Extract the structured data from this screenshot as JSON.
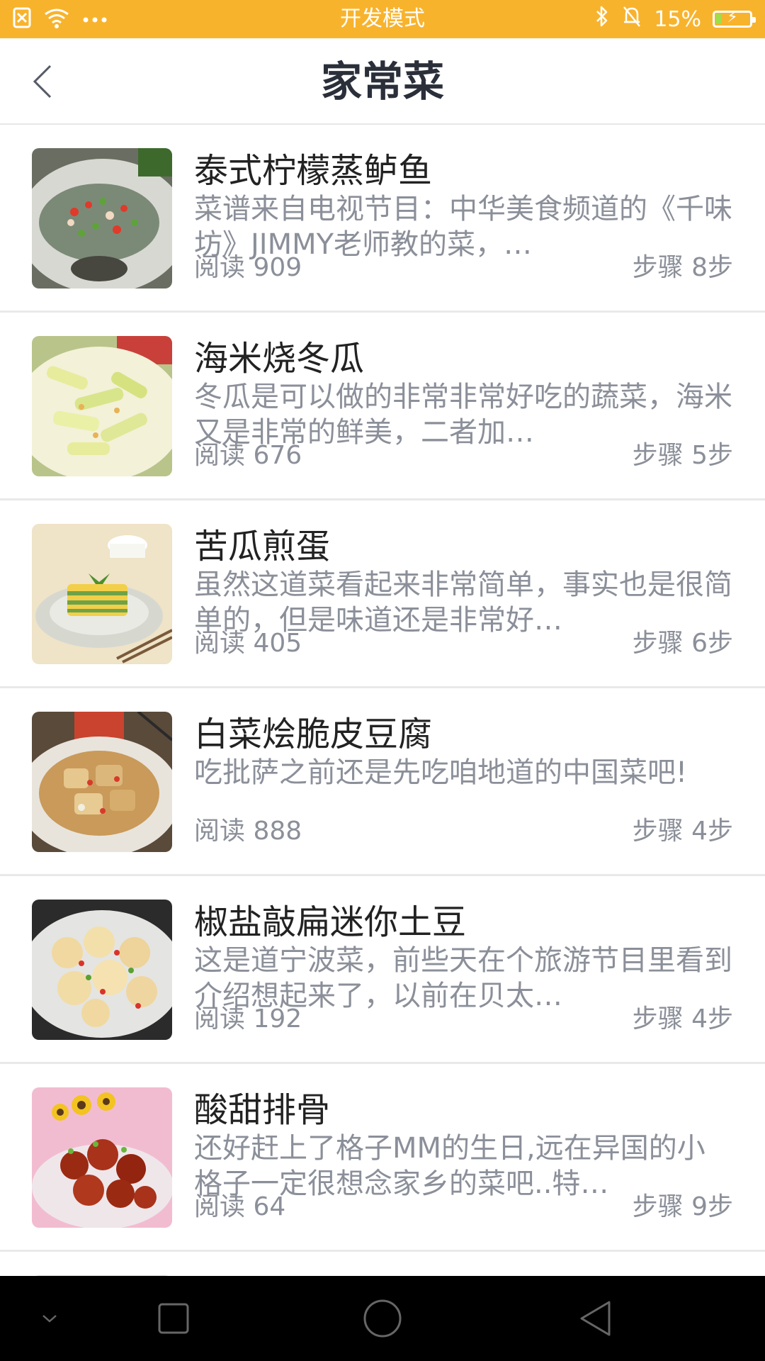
{
  "status_bar": {
    "center_text": "开发模式",
    "battery_text": "15%",
    "battery_level": 0.15,
    "background_color": "#f8b32d"
  },
  "nav": {
    "title": "家常菜"
  },
  "recipes": [
    {
      "title": "泰式柠檬蒸鲈鱼",
      "description": "菜谱来自电视节目：中华美食频道的《千味坊》JIMMY老师教的菜，…",
      "reads": "阅读  909",
      "steps": "步骤  8步"
    },
    {
      "title": "海米烧冬瓜",
      "description": "冬瓜是可以做的非常非常好吃的蔬菜，海米又是非常的鲜美，二者加…",
      "reads": "阅读  676",
      "steps": "步骤  5步"
    },
    {
      "title": "苦瓜煎蛋",
      "description": "虽然这道菜看起来非常简单，事实也是很简单的，但是味道还是非常好…",
      "reads": "阅读  405",
      "steps": "步骤  6步"
    },
    {
      "title": "白菜烩脆皮豆腐",
      "description": "吃批萨之前还是先吃咱地道的中国菜吧!",
      "reads": "阅读  888",
      "steps": "步骤  4步"
    },
    {
      "title": "椒盐敲扁迷你土豆",
      "description": "这是道宁波菜，前些天在个旅游节目里看到介绍想起来了，以前在贝太…",
      "reads": "阅读  192",
      "steps": "步骤  4步"
    },
    {
      "title": "酸甜排骨",
      "description": "还好赶上了格子MM的生日,远在异国的小格子一定很想念家乡的菜吧..特…",
      "reads": "阅读  64",
      "steps": "步骤  9步"
    }
  ]
}
